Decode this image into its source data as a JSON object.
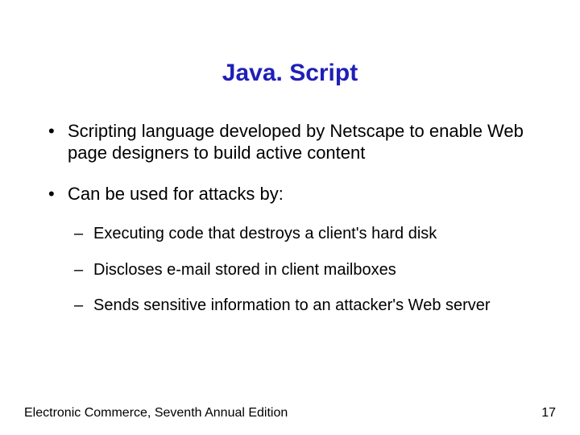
{
  "title": "Java. Script",
  "bullets": [
    {
      "text": "Scripting language developed by Netscape to enable Web page designers to build active content",
      "sub": []
    },
    {
      "text": "Can be used for attacks by:",
      "sub": [
        "Executing code that destroys a client's hard disk",
        "Discloses e-mail stored in client mailboxes",
        "Sends sensitive information to an attacker's Web server"
      ]
    }
  ],
  "footer": {
    "left": "Electronic Commerce, Seventh Annual Edition",
    "right": "17"
  }
}
